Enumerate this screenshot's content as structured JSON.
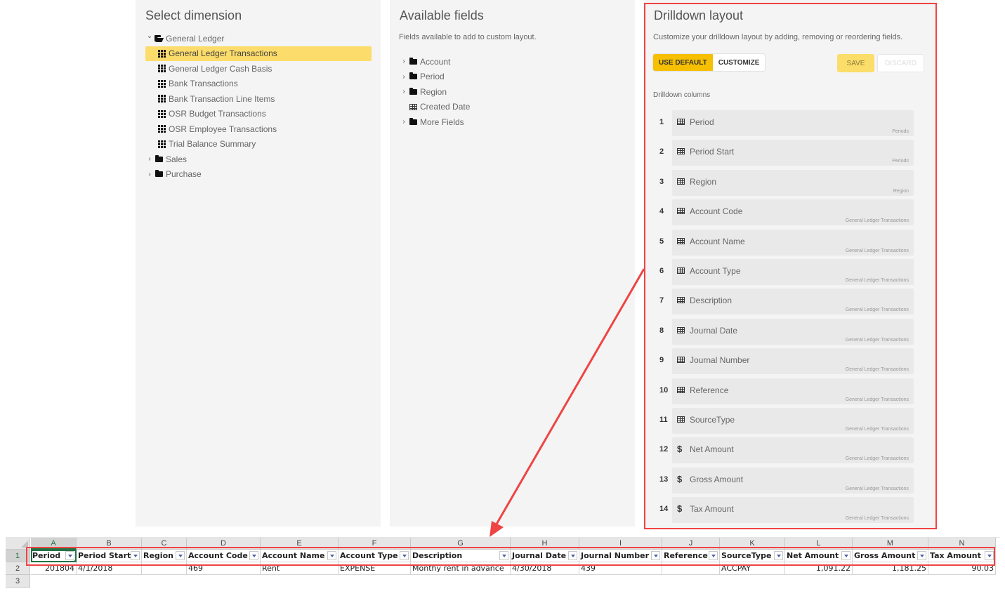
{
  "select_dimension": {
    "title": "Select dimension",
    "tree": [
      {
        "label": "General Ledger",
        "type": "folder-open",
        "expanded": true,
        "level": 1
      },
      {
        "label": "General Ledger Transactions",
        "type": "table",
        "level": 2,
        "selected": true
      },
      {
        "label": "General Ledger Cash Basis",
        "type": "table",
        "level": 2
      },
      {
        "label": "Bank Transactions",
        "type": "table",
        "level": 2
      },
      {
        "label": "Bank Transaction Line Items",
        "type": "table",
        "level": 2
      },
      {
        "label": "OSR Budget Transactions",
        "type": "table",
        "level": 2
      },
      {
        "label": "OSR Employee Transactions",
        "type": "table",
        "level": 2
      },
      {
        "label": "Trial Balance Summary",
        "type": "table",
        "level": 2
      },
      {
        "label": "Sales",
        "type": "folder",
        "expanded": false,
        "level": 1
      },
      {
        "label": "Purchase",
        "type": "folder",
        "expanded": false,
        "level": 1
      }
    ],
    "highlight_color": "#fcdc6a"
  },
  "available_fields": {
    "title": "Available fields",
    "subtitle": "Fields available to add to custom layout.",
    "tree": [
      {
        "label": "Account",
        "type": "folder",
        "expandable": true
      },
      {
        "label": "Period",
        "type": "folder",
        "expandable": true
      },
      {
        "label": "Region",
        "type": "folder",
        "expandable": true
      },
      {
        "label": "Created Date",
        "type": "field",
        "expandable": false
      },
      {
        "label": "More Fields",
        "type": "folder",
        "expandable": true
      }
    ]
  },
  "drilldown_layout": {
    "title": "Drilldown layout",
    "subtitle": "Customize your drilldown layout by adding, removing or reordering fields.",
    "use_default_label": "USE DEFAULT",
    "customize_label": "CUSTOMIZE",
    "save_label": "SAVE",
    "discard_label": "DISCARD",
    "columns_label": "Drilldown columns",
    "accent_color": "#f6c000",
    "columns": [
      {
        "num": "1",
        "name": "Period",
        "source": "Periods",
        "icon": "table"
      },
      {
        "num": "2",
        "name": "Period Start",
        "source": "Periods",
        "icon": "table"
      },
      {
        "num": "3",
        "name": "Region",
        "source": "Region",
        "icon": "table"
      },
      {
        "num": "4",
        "name": "Account Code",
        "source": "General Ledger Transactions",
        "icon": "table"
      },
      {
        "num": "5",
        "name": "Account Name",
        "source": "General Ledger Transactions",
        "icon": "table"
      },
      {
        "num": "6",
        "name": "Account Type",
        "source": "General Ledger Transactions",
        "icon": "table"
      },
      {
        "num": "7",
        "name": "Description",
        "source": "General Ledger Transactions",
        "icon": "table"
      },
      {
        "num": "8",
        "name": "Journal Date",
        "source": "General Ledger Transactions",
        "icon": "table"
      },
      {
        "num": "9",
        "name": "Journal Number",
        "source": "General Ledger Transactions",
        "icon": "table"
      },
      {
        "num": "10",
        "name": "Reference",
        "source": "General Ledger Transactions",
        "icon": "table"
      },
      {
        "num": "11",
        "name": "SourceType",
        "source": "General Ledger Transactions",
        "icon": "table"
      },
      {
        "num": "12",
        "name": "Net Amount",
        "source": "General Ledger Transactions",
        "icon": "dollar"
      },
      {
        "num": "13",
        "name": "Gross Amount",
        "source": "General Ledger Transactions",
        "icon": "dollar"
      },
      {
        "num": "14",
        "name": "Tax Amount",
        "source": "General Ledger Transactions",
        "icon": "dollar"
      }
    ]
  },
  "spreadsheet": {
    "column_letters": [
      "A",
      "B",
      "C",
      "D",
      "E",
      "F",
      "G",
      "H",
      "I",
      "J",
      "K",
      "L",
      "M",
      "N"
    ],
    "row_numbers": [
      "1",
      "2",
      "3"
    ],
    "headers": [
      "Period",
      "Period Start",
      "Region",
      "Account Code",
      "Account Name",
      "Account Type",
      "Description",
      "Journal Date",
      "Journal Number",
      "Reference",
      "SourceType",
      "Net Amount",
      "Gross Amount",
      "Tax Amount"
    ],
    "rows": [
      [
        "201804",
        "4/1/2018",
        "",
        "469",
        "Rent",
        "EXPENSE",
        "Monthy rent in advance",
        "4/30/2018",
        "439",
        "",
        "ACCPAY",
        "1,091.22",
        "1,181.25",
        "90.03"
      ]
    ],
    "numeric_columns": [
      0,
      11,
      12,
      13
    ],
    "annotation_color": "#ef4444"
  }
}
